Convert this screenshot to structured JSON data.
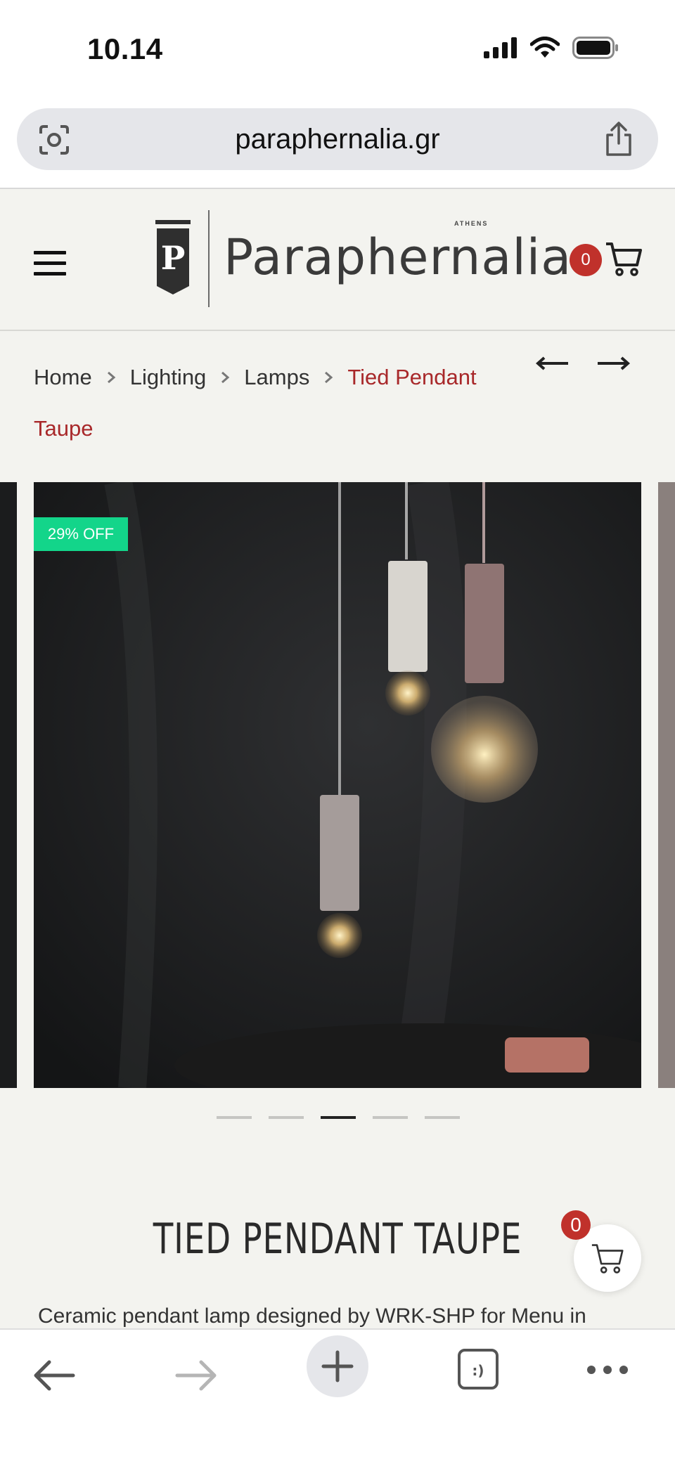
{
  "status_bar": {
    "time": "10.14"
  },
  "browser": {
    "url": "paraphernalia.gr"
  },
  "header": {
    "logo_text": "Paraphernalia",
    "logo_subtext": "ATHENS",
    "cart_count": "0"
  },
  "breadcrumb": {
    "items": [
      "Home",
      "Lighting",
      "Lamps"
    ],
    "current": "Tied Pendant Taupe"
  },
  "product": {
    "discount_badge": "29% OFF",
    "title": "TIED PENDANT TAUPE",
    "description": "Ceramic pendant lamp designed by WRK-SHP for Menu in",
    "gallery_active_index": 3,
    "gallery_total": 5
  },
  "floating_cart": {
    "count": "0"
  },
  "colors": {
    "accent_red": "#c0312b",
    "breadcrumb_current": "#a8282a",
    "badge_green": "#13d58a",
    "page_bg": "#f3f3ef"
  },
  "icons": {
    "url_left": "lens-icon",
    "url_right": "share-icon",
    "menu": "hamburger-icon",
    "cart": "cart-icon",
    "prev": "arrow-left-icon",
    "next": "arrow-right-icon",
    "bottom": [
      "back-icon",
      "forward-icon",
      "new-tab-icon",
      "tabs-icon",
      "more-icon"
    ]
  }
}
